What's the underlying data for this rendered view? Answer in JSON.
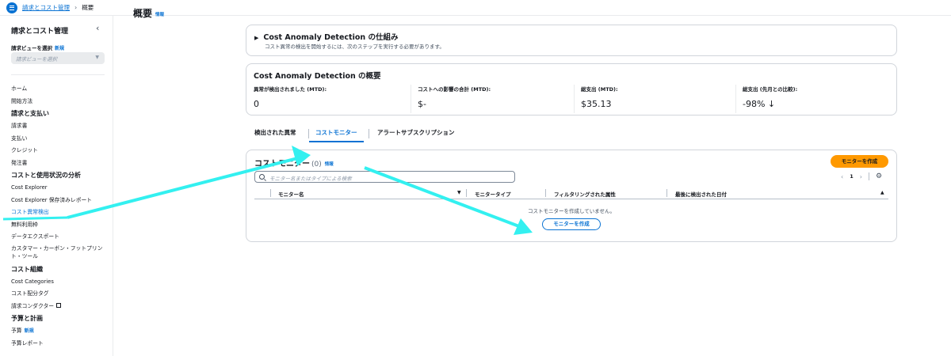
{
  "breadcrumb": {
    "parent": "請求とコスト管理",
    "current": "概要"
  },
  "sidebar": {
    "title": "請求とコスト管理",
    "view_label": "請求ビューを選択",
    "new_badge": "新規",
    "view_placeholder": "請求ビューを選択",
    "items": [
      {
        "label": "ホーム",
        "type": "item"
      },
      {
        "label": "開始方法",
        "type": "item"
      },
      {
        "label": "請求と支払い",
        "type": "head"
      },
      {
        "label": "請求書",
        "type": "item"
      },
      {
        "label": "支払い",
        "type": "item"
      },
      {
        "label": "クレジット",
        "type": "item"
      },
      {
        "label": "発注書",
        "type": "item"
      },
      {
        "label": "コストと使用状況の分析",
        "type": "head"
      },
      {
        "label": "Cost Explorer",
        "type": "item"
      },
      {
        "label": "Cost Explorer 保存済みレポート",
        "type": "item"
      },
      {
        "label": "コスト異常検出",
        "type": "active"
      },
      {
        "label": "無料利用枠",
        "type": "item"
      },
      {
        "label": "データエクスポート",
        "type": "item"
      },
      {
        "label": "カスタマー・カーボン・フットプリント・ツール",
        "type": "twoline"
      },
      {
        "label": "コスト組織",
        "type": "head"
      },
      {
        "label": "Cost Categories",
        "type": "item"
      },
      {
        "label": "コスト配分タグ",
        "type": "item"
      },
      {
        "label": "請求コンダクター",
        "type": "external"
      },
      {
        "label": "予算と計画",
        "type": "head"
      },
      {
        "label": "予算",
        "type": "new"
      },
      {
        "label": "予算レポート",
        "type": "item"
      }
    ]
  },
  "page": {
    "title": "概要",
    "info": "情報"
  },
  "how_it_works": {
    "title": "Cost Anomaly Detection の仕組み",
    "subtitle": "コスト異常の検出を開始するには、次のステップを実行する必要があります。"
  },
  "overview": {
    "title": "Cost Anomaly Detection の概要",
    "metrics": [
      {
        "label": "異常が検出されました (MTD):",
        "value": "0"
      },
      {
        "label": "コストへの影響の合計 (MTD):",
        "value": "$-"
      },
      {
        "label": "総支出 (MTD):",
        "value": "$35.13"
      },
      {
        "label": "総支出 (先月との比較):",
        "value": "-98% ↓"
      }
    ]
  },
  "tabs": [
    {
      "label": "検出された異常"
    },
    {
      "label": "コストモニター"
    },
    {
      "label": "アラートサブスクリプション"
    }
  ],
  "monitors": {
    "title": "コストモニター",
    "count": "(0)",
    "info": "情報",
    "create_label": "モニターを作成",
    "search_placeholder": "モニター名またはタイプによる検索",
    "page": "1",
    "columns": [
      "モニター名",
      "モニタータイプ",
      "フィルタリングされた属性",
      "最後に検出された日付"
    ],
    "empty_text": "コストモニターを作成していません。",
    "empty_button": "モニターを作成"
  },
  "colors": {
    "accent": "#0972d3",
    "primary_button": "#ff9900",
    "annotation_arrow": "#33f0f0"
  }
}
